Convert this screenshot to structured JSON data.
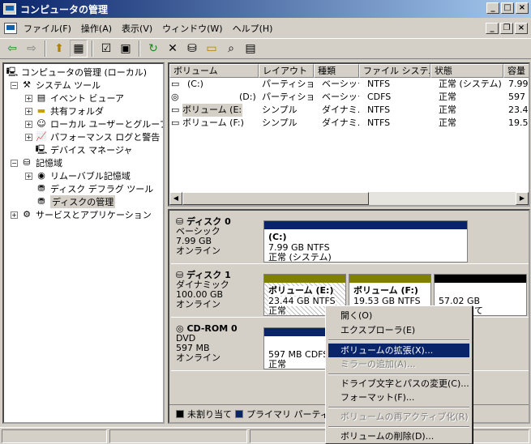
{
  "window": {
    "title": "コンピュータの管理"
  },
  "menu": [
    "ファイル(F)",
    "操作(A)",
    "表示(V)",
    "ウィンドウ(W)",
    "ヘルプ(H)"
  ],
  "tree": {
    "root": "コンピュータの管理 (ローカル)",
    "system_tools": "システム ツール",
    "event_viewer": "イベント ビューア",
    "shared_folders": "共有フォルダ",
    "local_users": "ローカル ユーザーとグループ",
    "perf_logs": "パフォーマンス ログと警告",
    "device_manager": "デバイス マネージャ",
    "storage": "記憶域",
    "removable": "リムーバブル記憶域",
    "defrag": "ディスク デフラグ ツール",
    "disk_mgmt": "ディスクの管理",
    "services": "サービスとアプリケーション"
  },
  "list": {
    "headers": [
      "ボリューム",
      "レイアウト",
      "種類",
      "ファイル システム",
      "状態",
      "容量"
    ],
    "rows": [
      [
        "(C:)",
        "パーティション",
        "ベーシック",
        "NTFS",
        "正常 (システム)",
        "7.99"
      ],
      [
        "(D:)",
        "パーティション",
        "ベーシック",
        "CDFS",
        "正常",
        "597 I"
      ],
      [
        "ボリューム (E:)",
        "シンプル",
        "ダイナミ...",
        "NTFS",
        "正常",
        "23.44"
      ],
      [
        "ボリューム (F:)",
        "シンプル",
        "ダイナミ...",
        "NTFS",
        "正常",
        "19.53"
      ]
    ]
  },
  "disks": [
    {
      "name": "ディスク 0",
      "type": "ベーシック",
      "size": "7.99 GB",
      "status": "オンライン"
    },
    {
      "name": "ディスク 1",
      "type": "ダイナミック",
      "size": "100.00 GB",
      "status": "オンライン"
    },
    {
      "name": "CD-ROM 0",
      "type": "DVD",
      "size": "597 MB",
      "status": "オンライン"
    }
  ],
  "parts": {
    "c_name": "(C:)",
    "c_info": "7.99 GB NTFS",
    "c_status": "正常 (システム)",
    "e_name": "ボリューム (E:)",
    "e_info": "23.44 GB NTFS",
    "e_status": "正常",
    "f_name": "ボリューム (F:)",
    "f_info": "19.53 GB NTFS",
    "f_status": "正常",
    "un_size": "57.02 GB",
    "un_status": "未割り当て",
    "cd_info": "597 MB CDFS",
    "cd_status": "正常"
  },
  "legend": {
    "unalloc": "未割り当て",
    "primary": "プライマリ パーティション"
  },
  "context": {
    "open": "開く(O)",
    "explore": "エクスプローラ(E)",
    "extend": "ボリュームの拡張(X)...",
    "mirror": "ミラーの追加(A)...",
    "change_letter": "ドライブ文字とパスの変更(C)...",
    "format": "フォーマット(F)...",
    "reactivate": "ボリュームの再アクティブ化(R)",
    "delete": "ボリュームの削除(D)..."
  },
  "colors": {
    "primary": "#0a246a",
    "simple": "#808000",
    "unalloc": "#000000"
  }
}
